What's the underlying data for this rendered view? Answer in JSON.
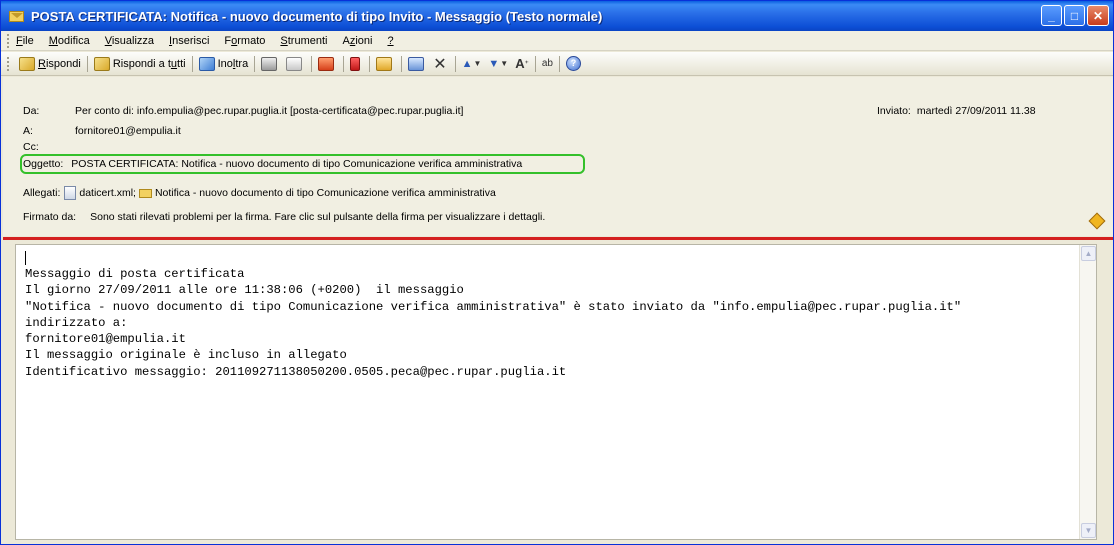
{
  "window": {
    "title": "POSTA CERTIFICATA: Notifica - nuovo documento di tipo Invito - Messaggio (Testo normale)",
    "buttons": {
      "minimize": "_",
      "maximize": "□",
      "close": "✕"
    }
  },
  "menu": {
    "items": [
      {
        "pre": "",
        "u": "F",
        "post": "ile"
      },
      {
        "pre": "",
        "u": "M",
        "post": "odifica"
      },
      {
        "pre": "",
        "u": "V",
        "post": "isualizza"
      },
      {
        "pre": "",
        "u": "I",
        "post": "nserisci"
      },
      {
        "pre": "F",
        "u": "o",
        "post": "rmato"
      },
      {
        "pre": "",
        "u": "S",
        "post": "trumenti"
      },
      {
        "pre": "A",
        "u": "z",
        "post": "ioni"
      },
      {
        "pre": "",
        "u": "?",
        "post": ""
      }
    ]
  },
  "toolbar": {
    "reply": {
      "pre": "",
      "u": "R",
      "post": "ispondi"
    },
    "reply_all": {
      "pre": "Rispondi a t",
      "u": "u",
      "post": "tti"
    },
    "forward": {
      "pre": "Ino",
      "u": "l",
      "post": "tra"
    },
    "font_glyph": "A",
    "spell_glyph": "ab",
    "delete_glyph": "✕",
    "help_glyph": "?"
  },
  "header": {
    "from_label": "Da:",
    "from_value": "Per conto di: info.empulia@pec.rupar.puglia.it [posta-certificata@pec.rupar.puglia.it]",
    "sent_label": "Inviato:",
    "sent_value": "martedì 27/09/2011 11.38",
    "to_label": "A:",
    "to_value": "fornitore01@empulia.it",
    "cc_label": "Cc:",
    "cc_value": "",
    "subject_label": "Oggetto:",
    "subject_value": "POSTA CERTIFICATA: Notifica - nuovo documento di tipo Comunicazione verifica amministrativa",
    "attachments_label": "Allegati:",
    "attachment_1": "daticert.xml;",
    "attachment_2": "Notifica - nuovo documento di tipo Comunicazione verifica amministrativa",
    "signed_label": "Firmato da:",
    "signed_value": "Sono stati rilevati problemi per la firma. Fare clic sul pulsante della firma per visualizzare i dettagli."
  },
  "body": {
    "text": "Messaggio di posta certificata\nIl giorno 27/09/2011 alle ore 11:38:06 (+0200)  il messaggio\n\"Notifica - nuovo documento di tipo Comunicazione verifica amministrativa\" è stato inviato da \"info.empulia@pec.rupar.puglia.it\"\nindirizzato a:\nfornitore01@empulia.it\nIl messaggio originale è incluso in allegato\nIdentificativo messaggio: 201109271138050200.0505.peca@pec.rupar.puglia.it"
  },
  "colors": {
    "titlebar": "#0d4fd6",
    "subject_highlight": "#34c02a",
    "separator_line": "#d42020"
  },
  "icons": [
    "mail-icon",
    "reply-icon",
    "reply-all-icon",
    "forward-icon",
    "print-icon",
    "copy-icon",
    "move-icon",
    "flag-icon",
    "folder-icon",
    "address-book-icon",
    "delete-icon",
    "up-arrow-icon",
    "down-arrow-icon",
    "font-size-icon",
    "spelling-icon",
    "help-icon",
    "attachment-icon",
    "warning-signature-icon"
  ]
}
